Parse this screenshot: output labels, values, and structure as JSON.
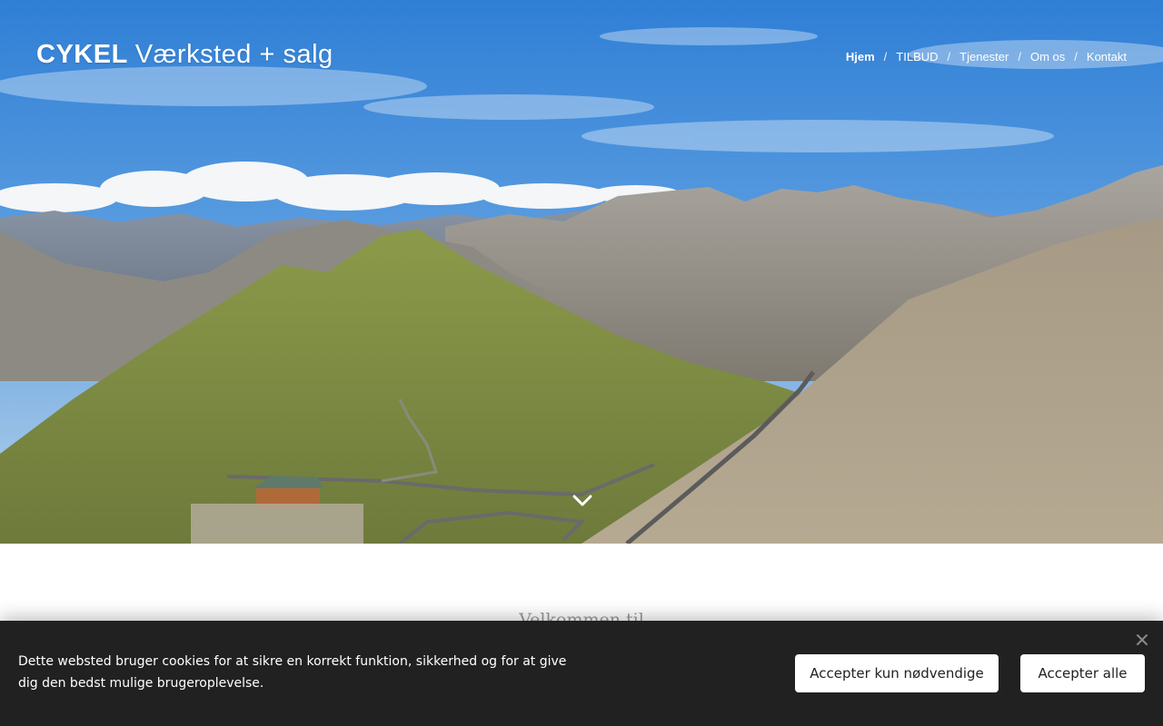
{
  "header": {
    "brand_bold": "CYKEL",
    "brand_light": "Værksted + salg",
    "nav": [
      {
        "label": "Hjem",
        "active": true
      },
      {
        "label": "TILBUD"
      },
      {
        "label": "Tjenester"
      },
      {
        "label": "Om os"
      },
      {
        "label": "Kontakt"
      }
    ],
    "separator": "/"
  },
  "hero": {
    "scroll_icon": "chevron-down-icon"
  },
  "main": {
    "welcome_partial": "Velkommen til"
  },
  "cookie_banner": {
    "text": "Dette websted bruger cookies for at sikre en korrekt funktion, sikkerhed og for at give dig den bedst mulige brugeroplevelse.",
    "accept_necessary": "Accepter kun nødvendige",
    "accept_all": "Accepter alle",
    "close_icon": "close-icon",
    "background": "#212121"
  }
}
